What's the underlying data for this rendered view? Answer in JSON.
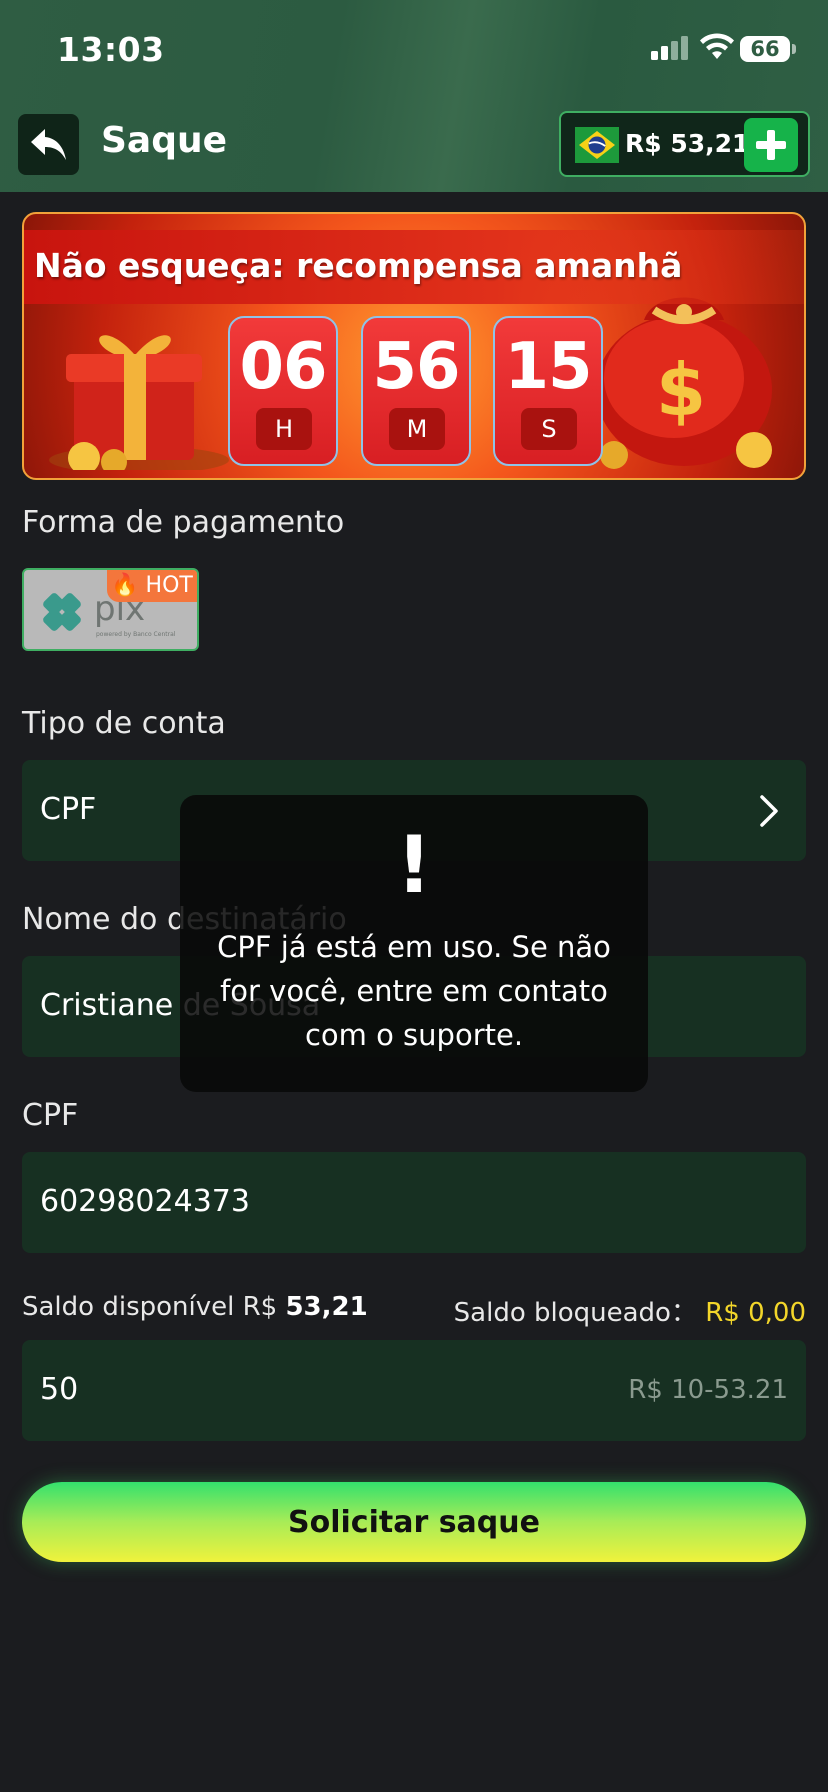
{
  "status_bar": {
    "time": "13:03",
    "battery": "66"
  },
  "header": {
    "title": "Saque",
    "balance": "R$ 53,21"
  },
  "banner": {
    "title": "Não esqueça: recompensa amanhã",
    "timer": [
      {
        "value": "06",
        "unit": "H"
      },
      {
        "value": "56",
        "unit": "M"
      },
      {
        "value": "15",
        "unit": "S"
      }
    ]
  },
  "payment": {
    "label": "Forma de pagamento",
    "method": "pix",
    "method_subtext": "powered by Banco Central",
    "badge": "HOT"
  },
  "account_type": {
    "label": "Tipo de conta",
    "value": "CPF"
  },
  "recipient": {
    "label": "Nome do destinatário",
    "value": "Cristiane de Sousa"
  },
  "cpf": {
    "label": "CPF",
    "value": "60298024373"
  },
  "balances": {
    "available_label": "Saldo disponível R$",
    "available_value": "53,21",
    "blocked_label": "Saldo bloqueado：",
    "blocked_value": "R$ 0,00"
  },
  "amount": {
    "value": "50",
    "hint": "R$ 10-53.21"
  },
  "submit_label": "Solicitar saque",
  "toast": {
    "icon": "!",
    "message": "CPF já está em uso. Se não for você, entre em contato com o suporte."
  },
  "colors": {
    "header_bg": "#2f5d43",
    "page_bg": "#1b1c1f",
    "field_bg": "#173022",
    "accent_green": "#16b34a",
    "blocked_yellow": "#f3d62a"
  }
}
